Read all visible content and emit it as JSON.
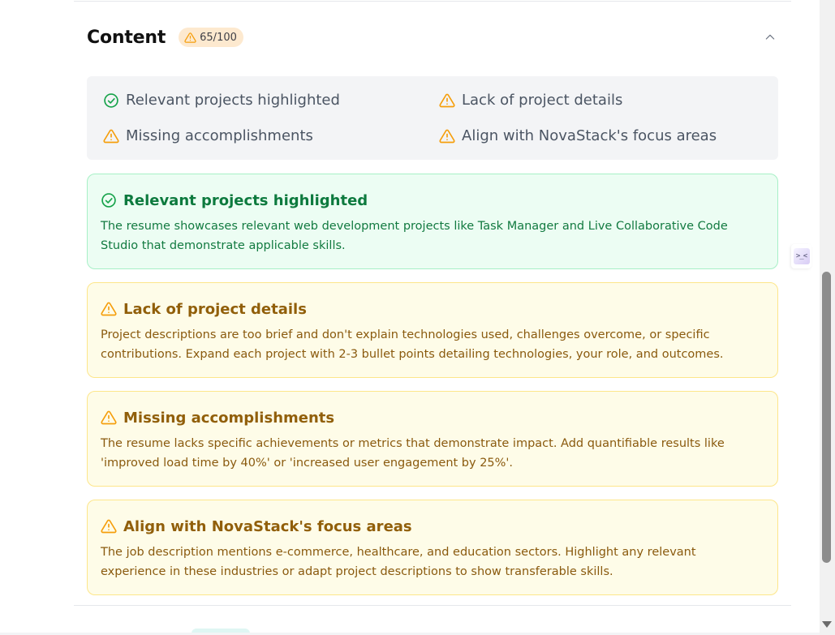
{
  "section": {
    "title": "Content",
    "score": "65/100",
    "collapse_icon": "chevron-up-icon"
  },
  "summary": [
    {
      "status": "ok",
      "label": "Relevant projects highlighted"
    },
    {
      "status": "warn",
      "label": "Lack of project details"
    },
    {
      "status": "warn",
      "label": "Missing accomplishments"
    },
    {
      "status": "warn",
      "label": "Align with NovaStack's focus areas"
    }
  ],
  "cards": [
    {
      "status": "ok",
      "title": "Relevant projects highlighted",
      "description": "The resume showcases relevant web development projects like Task Manager and Live Collaborative Code Studio that demonstrate applicable skills."
    },
    {
      "status": "warn",
      "title": "Lack of project details",
      "description": "Project descriptions are too brief and don't explain technologies used, challenges overcome, or specific contributions. Expand each project with 2-3 bullet points detailing technologies, your role, and outcomes."
    },
    {
      "status": "warn",
      "title": "Missing accomplishments",
      "description": "The resume lacks specific achievements or metrics that demonstrate impact. Add quantifiable results like 'improved load time by 40%' or 'increased user engagement by 25%'."
    },
    {
      "status": "warn",
      "title": "Align with NovaStack's focus areas",
      "description": "The job description mentions e-commerce, healthcare, and education sectors. Highlight any relevant experience in these industries or adapt project descriptions to show transferable skills."
    }
  ],
  "side_widget": {
    "glyph": ">_<",
    "icon": "assistant-icon"
  },
  "colors": {
    "ok": "#16a34a",
    "warn": "#f59e0b",
    "ok_bg": "#ecfdf3",
    "warn_bg": "#fefce8",
    "badge_bg": "#fde9cf"
  }
}
